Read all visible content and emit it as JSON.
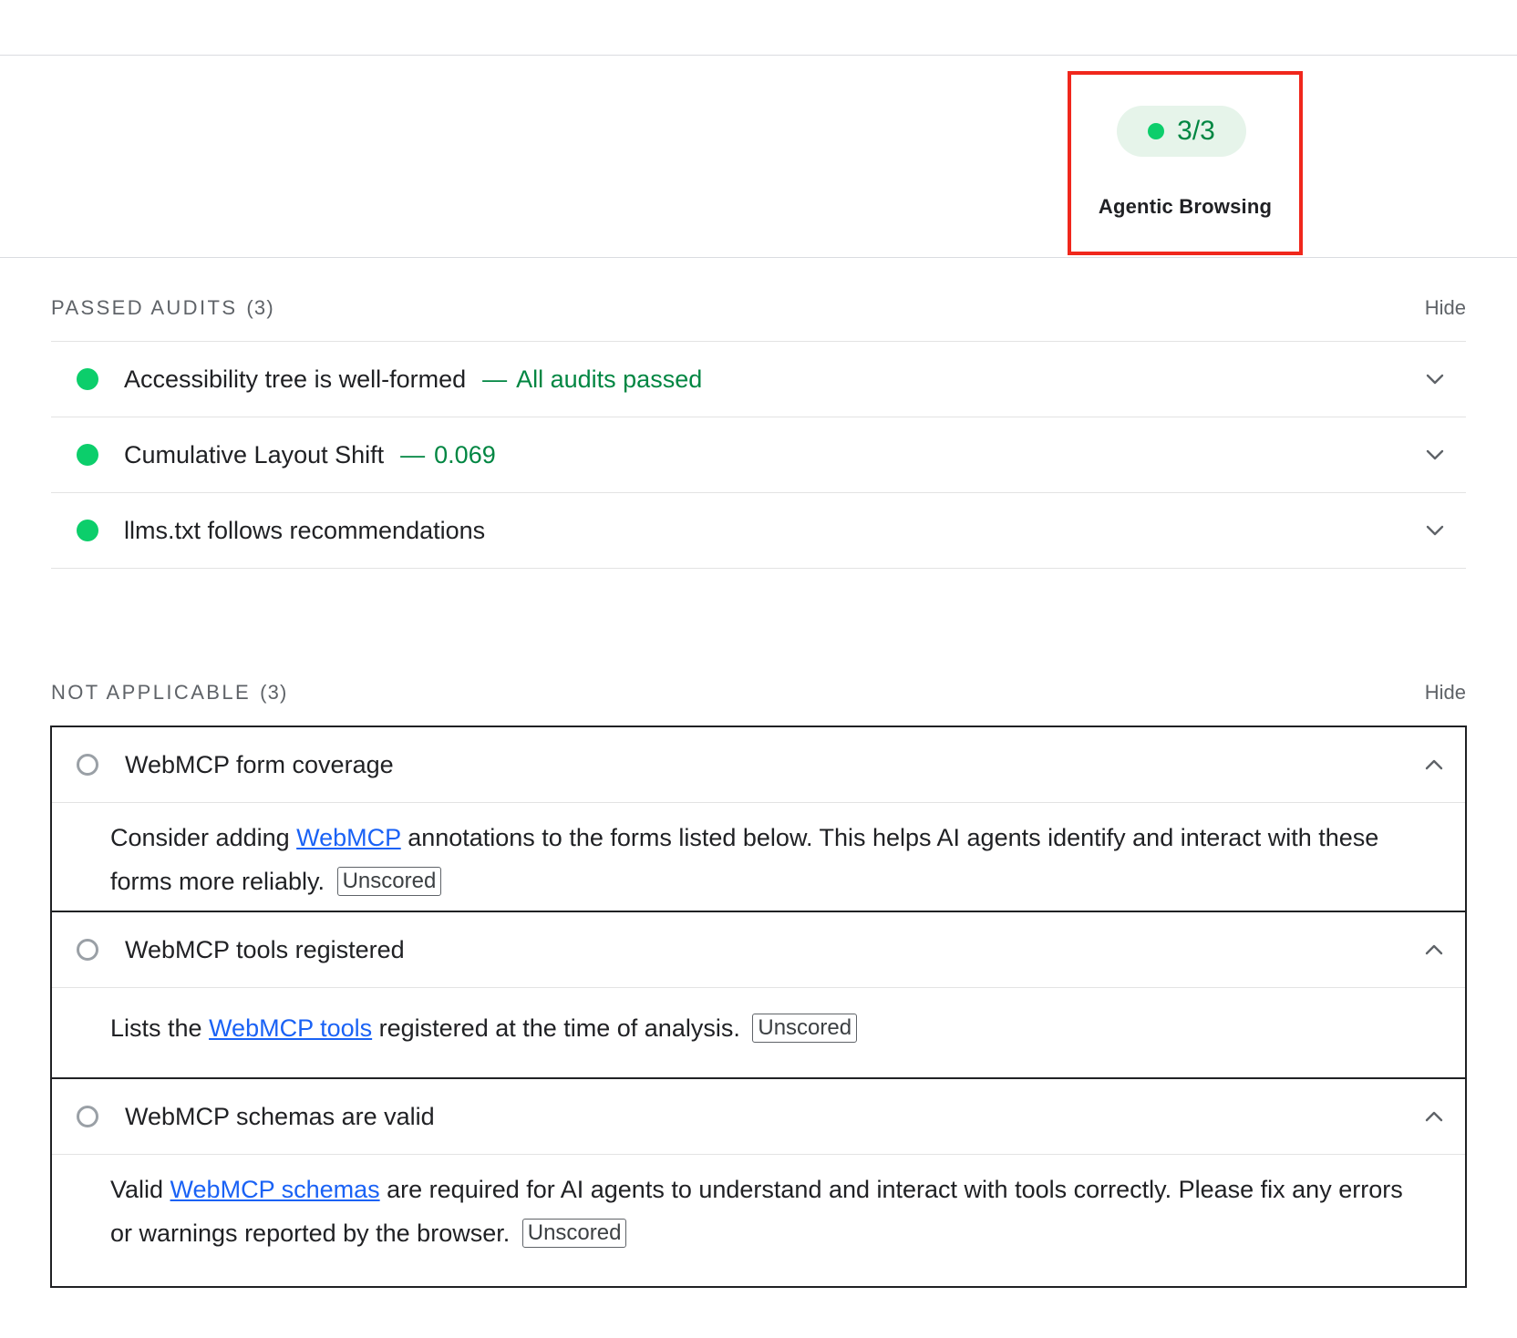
{
  "category": {
    "score": "3/3",
    "label": "Agentic Browsing",
    "colors": {
      "pass": "#0cce6b",
      "pass_text": "#018642",
      "highlight_box": "#f0271c",
      "link": "#1a62f5"
    }
  },
  "passed_audits": {
    "title": "PASSED AUDITS",
    "count": "(3)",
    "toggle": "Hide",
    "items": [
      {
        "title": "Accessibility tree is well-formed",
        "sep": "—",
        "value": "All audits passed",
        "icon": "pass-dot"
      },
      {
        "title": "Cumulative Layout Shift",
        "sep": "—",
        "value": "0.069",
        "icon": "pass-dot"
      },
      {
        "title": "llms.txt follows recommendations",
        "sep": "",
        "value": "",
        "icon": "pass-dot"
      }
    ]
  },
  "not_applicable": {
    "title": "NOT APPLICABLE",
    "count": "(3)",
    "toggle": "Hide",
    "items": [
      {
        "title": "WebMCP form coverage",
        "desc_before": "Consider adding ",
        "link": "WebMCP",
        "desc_after": " annotations to the forms listed below. This helps AI agents identify and interact with these forms more reliably.",
        "badge": "Unscored"
      },
      {
        "title": "WebMCP tools registered",
        "desc_before": "Lists the ",
        "link": "WebMCP tools",
        "desc_after": " registered at the time of analysis.",
        "badge": "Unscored"
      },
      {
        "title": "WebMCP schemas are valid",
        "desc_before": "Valid ",
        "link": "WebMCP schemas",
        "desc_after": " are required for AI agents to understand and interact with tools correctly. Please fix any errors or warnings reported by the browser.",
        "badge": "Unscored"
      }
    ]
  }
}
